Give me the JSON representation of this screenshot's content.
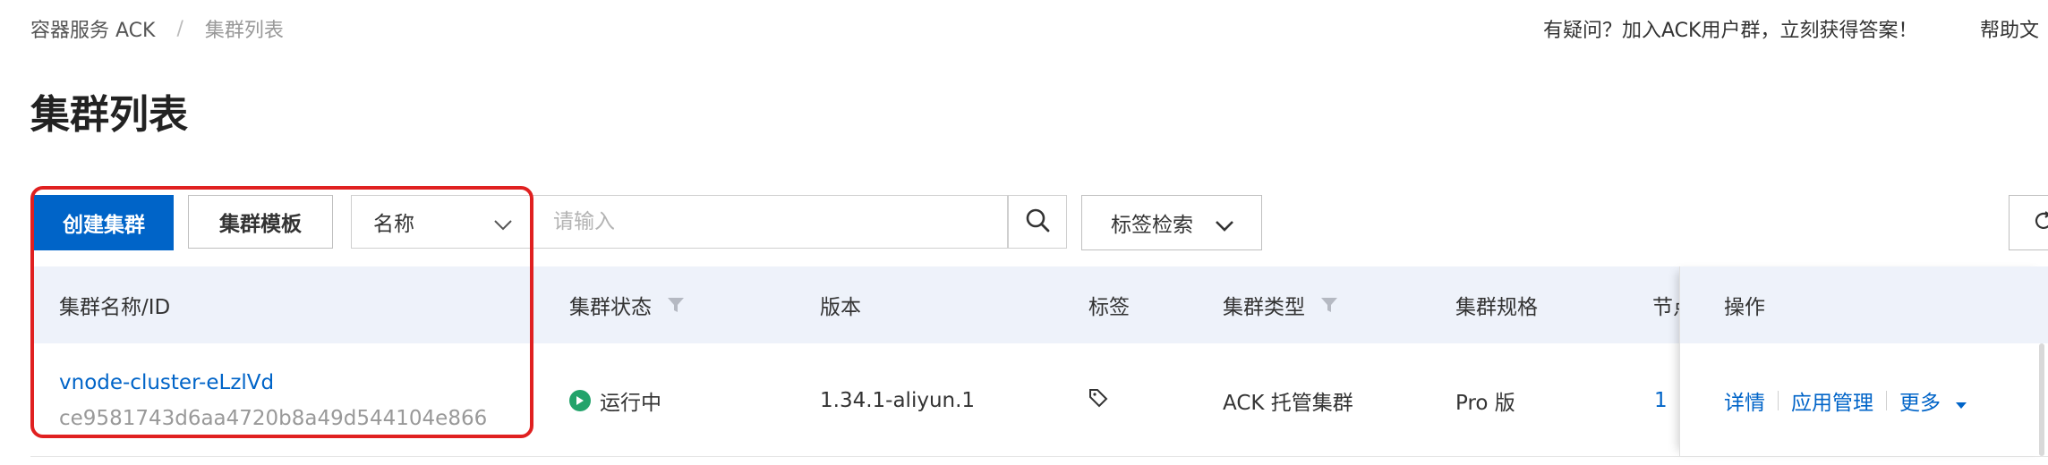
{
  "breadcrumb": {
    "root": "容器服务 ACK",
    "separator": "/",
    "current": "集群列表"
  },
  "header": {
    "help_text": "有疑问？加入ACK用户群，立刻获得答案！",
    "help_doc": "帮助文"
  },
  "page": {
    "title": "集群列表"
  },
  "toolbar": {
    "create_label": "创建集群",
    "template_label": "集群模板",
    "search_field_selected": "名称",
    "search_placeholder": "请输入",
    "tag_search_label": "标签检索"
  },
  "table": {
    "columns": {
      "name": "集群名称/ID",
      "status": "集群状态",
      "version": "版本",
      "tags": "标签",
      "type": "集群类型",
      "spec": "集群规格",
      "nodes": "节点",
      "ops": "操作"
    },
    "rows": [
      {
        "name": "vnode-cluster-eLzlVd",
        "id": "ce9581743d6aa4720b8a49d544104e866",
        "status": "运行中",
        "version": "1.34.1-aliyun.1",
        "type": "ACK 托管集群",
        "spec": "Pro 版",
        "nodes": "1",
        "ops": {
          "details": "详情",
          "app_manage": "应用管理",
          "more": "更多"
        }
      }
    ]
  },
  "colors": {
    "primary": "#0064c8",
    "running": "#23a36b",
    "highlight": "#e02020",
    "header_bg": "#eef2fa"
  }
}
